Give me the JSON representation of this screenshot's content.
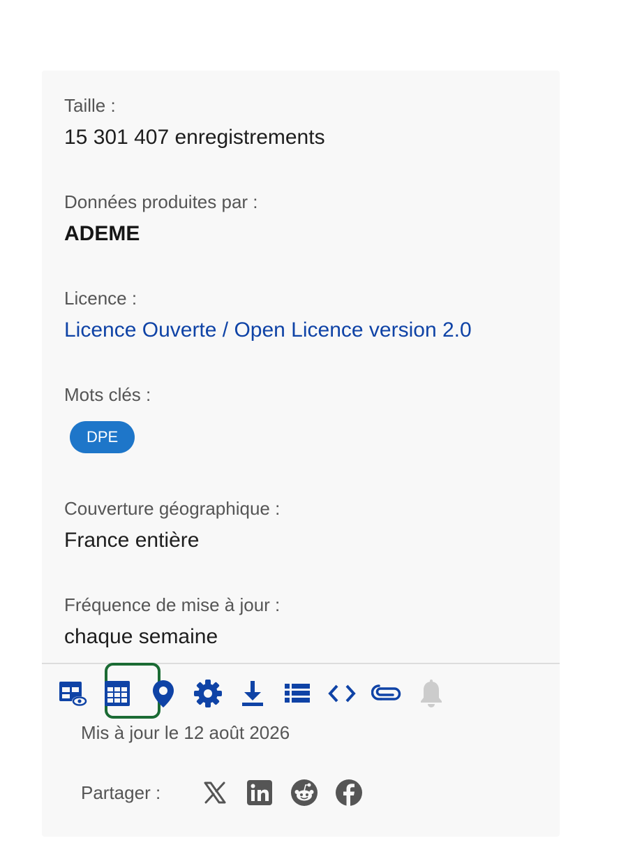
{
  "fields": {
    "size": {
      "label": "Taille :",
      "value": "15 301 407 enregistrements"
    },
    "producer": {
      "label": "Données produites par :",
      "value": "ADEME"
    },
    "license": {
      "label": "Licence :",
      "value": "Licence Ouverte / Open Licence version 2.0"
    },
    "keywords": {
      "label": "Mots clés :",
      "tags": [
        "DPE"
      ]
    },
    "coverage": {
      "label": "Couverture géographique :",
      "value": "France entière"
    },
    "frequency": {
      "label": "Fréquence de mise à jour :",
      "value": "chaque semaine"
    }
  },
  "toolbar": {
    "icons": [
      "table-preview-icon",
      "table-icon",
      "map-pin-icon",
      "gear-icon",
      "download-icon",
      "list-icon",
      "code-icon",
      "paperclip-icon",
      "bell-icon"
    ],
    "selected": "table-icon",
    "accent_color": "#0f43a6",
    "selected_color": "#1b6b34",
    "disabled_color": "#cccccc"
  },
  "updated": "Mis à jour le 12 août 2026",
  "share": {
    "label": "Partager :",
    "icons": [
      "x-icon",
      "linkedin-icon",
      "reddit-icon",
      "facebook-icon"
    ],
    "icon_color": "#555555"
  },
  "colors": {
    "card_background": "#f8f8f8",
    "tag_background": "#1e76c9",
    "link": "#0f43a6"
  }
}
